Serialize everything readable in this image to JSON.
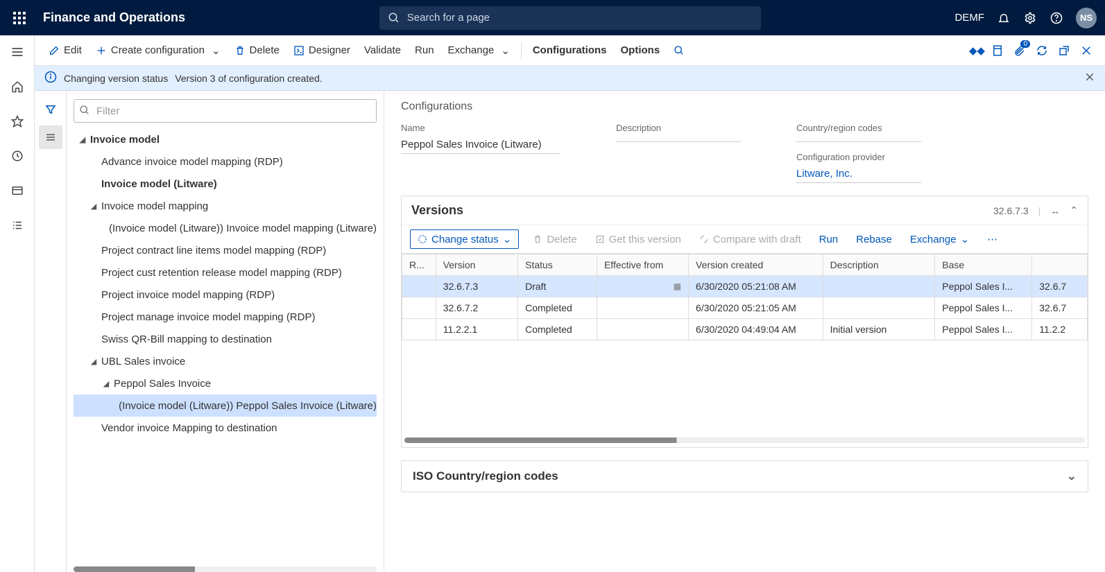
{
  "header": {
    "app_title": "Finance and Operations",
    "search_placeholder": "Search for a page",
    "entity": "DEMF",
    "avatar": "NS"
  },
  "action_bar": {
    "edit": "Edit",
    "create": "Create configuration",
    "delete": "Delete",
    "designer": "Designer",
    "validate": "Validate",
    "run": "Run",
    "exchange": "Exchange",
    "configurations": "Configurations",
    "options": "Options",
    "badge_count": "0"
  },
  "info": {
    "title": "Changing version status",
    "message": "Version 3 of configuration created."
  },
  "filter_placeholder": "Filter",
  "tree": [
    {
      "label": "Invoice model",
      "bold": true,
      "level": 0,
      "caret": true
    },
    {
      "label": "Advance invoice model mapping (RDP)",
      "level": 1
    },
    {
      "label": "Invoice model (Litware)",
      "bold": true,
      "level": 1
    },
    {
      "label": "Invoice model mapping",
      "level": 1,
      "caret": true
    },
    {
      "label": "(Invoice model (Litware)) Invoice model mapping (Litware)",
      "level": 2
    },
    {
      "label": "Project contract line items model mapping (RDP)",
      "level": 1
    },
    {
      "label": "Project cust retention release model mapping (RDP)",
      "level": 1
    },
    {
      "label": "Project invoice model mapping (RDP)",
      "level": 1
    },
    {
      "label": "Project manage invoice model mapping (RDP)",
      "level": 1
    },
    {
      "label": "Swiss QR-Bill mapping to destination",
      "level": 1
    },
    {
      "label": "UBL Sales invoice",
      "level": 1,
      "caret": true
    },
    {
      "label": "Peppol Sales Invoice",
      "level": 2,
      "caret": true
    },
    {
      "label": "(Invoice model (Litware)) Peppol Sales Invoice (Litware)",
      "level": 3,
      "selected": true
    },
    {
      "label": "Vendor invoice Mapping to destination",
      "level": 1
    }
  ],
  "details": {
    "section_title": "Configurations",
    "name_label": "Name",
    "name_value": "Peppol Sales Invoice (Litware)",
    "description_label": "Description",
    "description_value": "",
    "country_label": "Country/region codes",
    "country_value": "",
    "provider_label": "Configuration provider",
    "provider_value": "Litware, Inc."
  },
  "versions": {
    "title": "Versions",
    "current": "32.6.7.3",
    "toolbar": {
      "change_status": "Change status",
      "delete": "Delete",
      "get_version": "Get this version",
      "compare": "Compare with draft",
      "run": "Run",
      "rebase": "Rebase",
      "exchange": "Exchange"
    },
    "columns": {
      "r": "R...",
      "version": "Version",
      "status": "Status",
      "effective_from": "Effective from",
      "created": "Version created",
      "description": "Description",
      "base": "Base",
      "basev": ""
    },
    "rows": [
      {
        "version": "32.6.7.3",
        "status": "Draft",
        "effective": "",
        "created": "6/30/2020 05:21:08 AM",
        "description": "",
        "base": "Peppol Sales I...",
        "basev": "32.6.7",
        "selected": true
      },
      {
        "version": "32.6.7.2",
        "status": "Completed",
        "effective": "",
        "created": "6/30/2020 05:21:05 AM",
        "description": "",
        "base": "Peppol Sales I...",
        "basev": "32.6.7"
      },
      {
        "version": "11.2.2.1",
        "status": "Completed",
        "effective": "",
        "created": "6/30/2020 04:49:04 AM",
        "description": "Initial version",
        "base": "Peppol Sales I...",
        "basev": "11.2.2"
      }
    ]
  },
  "iso_title": "ISO Country/region codes"
}
